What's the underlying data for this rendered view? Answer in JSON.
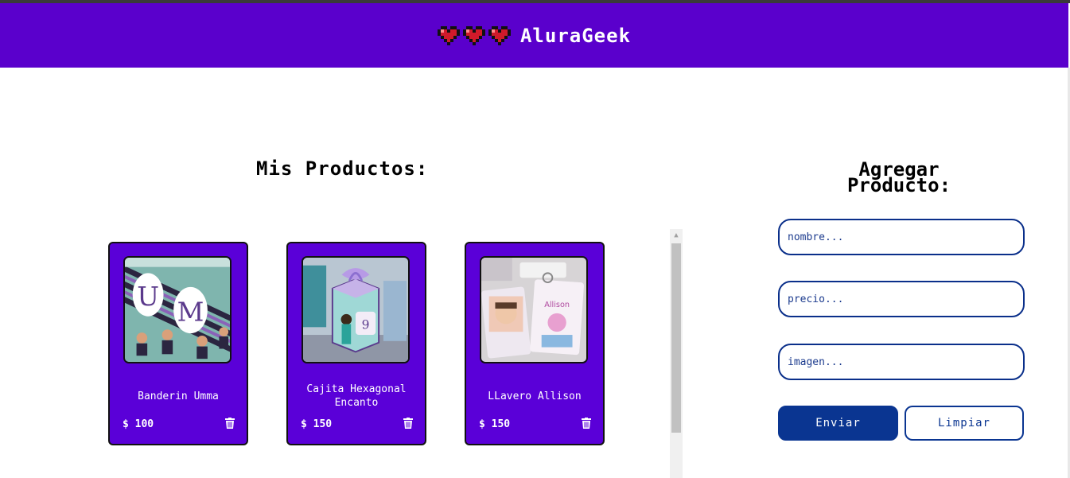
{
  "header": {
    "brand": "AluraGeek",
    "icons": [
      "heart-icon",
      "heart-icon",
      "heart-icon"
    ]
  },
  "products_section": {
    "title": "Mis Productos:",
    "items": [
      {
        "name": "Banderin Umma",
        "price": "$ 100",
        "image_icon": "banner-photo"
      },
      {
        "name": "Cajita Hexagonal Encanto",
        "price": "$ 150",
        "image_icon": "box-photo"
      },
      {
        "name": "LLavero Allison",
        "price": "$ 150",
        "image_icon": "keychain-photo"
      }
    ],
    "delete_icon": "trash-icon"
  },
  "form": {
    "title": "Agregar Producto:",
    "fields": {
      "name_placeholder": "nombre...",
      "price_placeholder": "precio...",
      "image_placeholder": "imagen..."
    },
    "send_label": "Enviar",
    "clear_label": "Limpiar"
  },
  "colors": {
    "header_bg": "#5a00cc",
    "card_bg": "#5a00d8",
    "primary_blue": "#0a3591"
  }
}
